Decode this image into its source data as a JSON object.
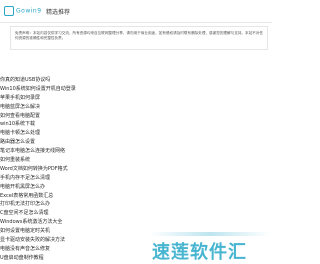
{
  "header": {
    "logo_text": "Gowin9",
    "nav_home": "精选推荐"
  },
  "notice": {
    "text": "免责声明：本站内容仅供学习交流，所有资源均来自互联网整理分享，请勿用于商业用途，如有侵权请及时联系删除处理，感谢您的理解与支持。本站不对任何资源的准确性和完整性负责。"
  },
  "articles": [
    "你真的知道USB协议吗",
    "Win10系统如何设置开机自动登录",
    "苹果手机如何录屏",
    "电脑蓝屏怎么解决",
    "如何查看电脑配置",
    "win10系统下载",
    "电脑卡顿怎么处理",
    "路由器怎么设置",
    "笔记本电脑怎么连接无线网络",
    "如何重装系统",
    "Word文档如何转换为PDF格式",
    "手机内存不足怎么清理",
    "电脑开机黑屏怎么办",
    "Excel表格常用函数汇总",
    "打印机无法打印怎么办",
    "C盘空间不足怎么清理",
    "Windows系统激活方法大全",
    "如何设置电脑定时关机",
    "显卡驱动安装失败的解决方法",
    "电脑没有声音怎么修复",
    "U盘启动盘制作教程"
  ],
  "watermark": "速莲软件汇"
}
